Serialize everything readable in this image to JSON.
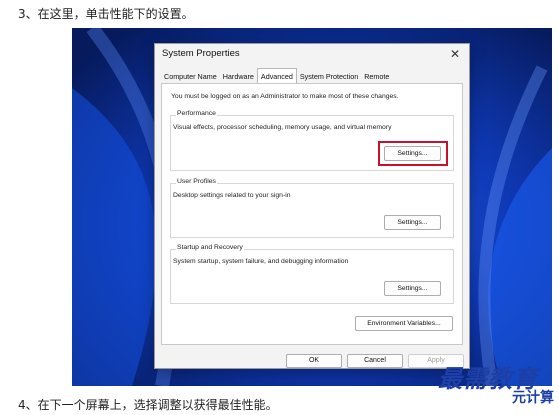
{
  "article": {
    "step3": "3、在这里，单击性能下的设置。",
    "step4": "4、在下一个屏幕上，选择调整以获得最佳性能。"
  },
  "dialog": {
    "title": "System Properties",
    "close_icon": "close-icon",
    "tabs": [
      {
        "label": "Computer Name",
        "active": false
      },
      {
        "label": "Hardware",
        "active": false
      },
      {
        "label": "Advanced",
        "active": true
      },
      {
        "label": "System Protection",
        "active": false
      },
      {
        "label": "Remote",
        "active": false
      }
    ],
    "notice": "You must be logged on as an Administrator to make most of these changes.",
    "performance": {
      "label": "Performance",
      "description": "Visual effects, processor scheduling, memory usage, and virtual memory",
      "button": "Settings..."
    },
    "user_profiles": {
      "label": "User Profiles",
      "description": "Desktop settings related to your sign-in",
      "button": "Settings..."
    },
    "startup_recovery": {
      "label": "Startup and Recovery",
      "description": "System startup, system failure, and debugging information",
      "button": "Settings..."
    },
    "env_button": "Environment Variables...",
    "ok": "OK",
    "cancel": "Cancel",
    "apply": "Apply"
  },
  "watermark": {
    "main": "最需教育",
    "sub": "元计算"
  },
  "colors": {
    "highlight": "#c8102e",
    "wallpaper": "#0a2a7a",
    "watermark": "#1d3fa6"
  }
}
